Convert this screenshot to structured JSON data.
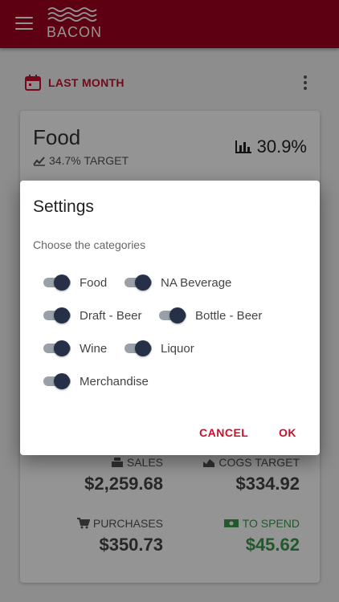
{
  "app": {
    "logo_text": "BACON"
  },
  "period": {
    "label": "LAST MONTH"
  },
  "card": {
    "title": "Food",
    "target_text": "34.7% TARGET",
    "percent": "30.9%",
    "stats": {
      "sales": {
        "label": "SALES",
        "value": "$2,259.68"
      },
      "cogs_target": {
        "label": "COGS TARGET",
        "value": "$334.92"
      },
      "purchases": {
        "label": "PURCHASES",
        "value": "$350.73"
      },
      "to_spend": {
        "label": "TO SPEND",
        "value": "$45.62",
        "color": "#3a9a4a"
      }
    }
  },
  "dialog": {
    "title": "Settings",
    "subtitle": "Choose the categories",
    "options": [
      {
        "label": "Food",
        "on": true
      },
      {
        "label": "NA Beverage",
        "on": true
      },
      {
        "label": "Draft - Beer",
        "on": true
      },
      {
        "label": "Bottle - Beer",
        "on": true
      },
      {
        "label": "Wine",
        "on": true
      },
      {
        "label": "Liquor",
        "on": true
      },
      {
        "label": "Merchandise",
        "on": true
      }
    ],
    "cancel_label": "CANCEL",
    "ok_label": "OK"
  },
  "colors": {
    "brand": "#a0001e",
    "accent": "#c8102e",
    "toggle_thumb": "#263147"
  }
}
